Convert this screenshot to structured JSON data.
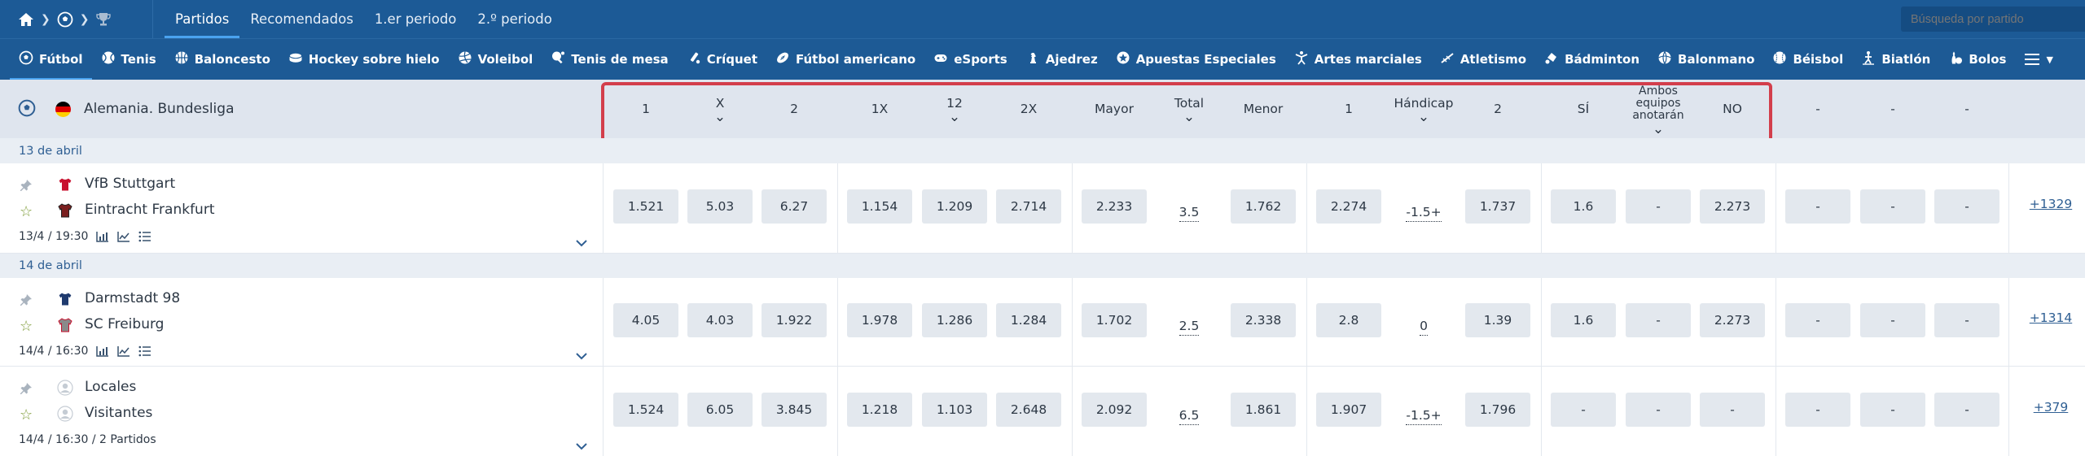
{
  "topnav": {
    "tabs": [
      "Partidos",
      "Recomendados",
      "1.er periodo",
      "2.º periodo"
    ],
    "active_tab": "Partidos",
    "search_placeholder": "Búsqueda por partido"
  },
  "sports": [
    {
      "label": "Fútbol",
      "icon": "soccer-ball-icon",
      "active": true
    },
    {
      "label": "Tenis",
      "icon": "tennis-ball-icon"
    },
    {
      "label": "Baloncesto",
      "icon": "basketball-icon"
    },
    {
      "label": "Hockey sobre hielo",
      "icon": "hockey-puck-icon"
    },
    {
      "label": "Voleibol",
      "icon": "volleyball-icon"
    },
    {
      "label": "Tenis de mesa",
      "icon": "table-tennis-icon"
    },
    {
      "label": "Críquet",
      "icon": "cricket-bat-icon"
    },
    {
      "label": "Fútbol americano",
      "icon": "american-football-icon"
    },
    {
      "label": "eSports",
      "icon": "gamepad-icon"
    },
    {
      "label": "Ajedrez",
      "icon": "chess-icon"
    },
    {
      "label": "Apuestas Especiales",
      "icon": "star-circle-icon"
    },
    {
      "label": "Artes marciales",
      "icon": "martial-arts-icon"
    },
    {
      "label": "Atletismo",
      "icon": "athletics-icon"
    },
    {
      "label": "Bádminton",
      "icon": "shuttlecock-icon"
    },
    {
      "label": "Balonmano",
      "icon": "handball-icon"
    },
    {
      "label": "Béisbol",
      "icon": "baseball-icon"
    },
    {
      "label": "Biatlón",
      "icon": "biathlon-icon"
    },
    {
      "label": "Bolos",
      "icon": "bowling-pin-icon"
    }
  ],
  "league": {
    "name": "Alemania. Bundesliga",
    "flag_colors": [
      "#000000",
      "#dd0000",
      "#ffce00"
    ],
    "columns": [
      "1",
      "X",
      "2",
      "1X",
      "12",
      "2X",
      "Mayor",
      "Total",
      "Menor",
      "1",
      "Hándicap",
      "2",
      "SÍ",
      "Ambos equipos anotarán",
      "NO",
      "-",
      "-",
      "-"
    ]
  },
  "dates": [
    "13 de abril",
    "14 de abril"
  ],
  "matches": [
    {
      "home": "VfB Stuttgart",
      "away": "Eintracht Frankfurt",
      "home_jersey": [
        "#c8102e",
        "#ffffff"
      ],
      "away_jersey": [
        "#7a1f1f",
        "#222222"
      ],
      "meta": "13/4 / 19:30",
      "odds": [
        "1.521",
        "5.03",
        "6.27",
        "1.154",
        "1.209",
        "2.714",
        "2.233",
        "1.762",
        "2.274",
        "1.737",
        "1.6",
        "-",
        "2.273",
        "-",
        "-",
        "-"
      ],
      "total": "3.5",
      "handicap": "-1.5+",
      "more": "+1329"
    },
    {
      "home": "Darmstadt 98",
      "away": "SC Freiburg",
      "home_jersey": [
        "#1f3a6e",
        "#ffffff"
      ],
      "away_jersey": [
        "#8a8a8a",
        "#c8102e"
      ],
      "meta": "14/4 / 16:30",
      "odds": [
        "4.05",
        "4.03",
        "1.922",
        "1.978",
        "1.286",
        "1.284",
        "1.702",
        "2.338",
        "2.8",
        "1.39",
        "1.6",
        "-",
        "2.273",
        "-",
        "-",
        "-"
      ],
      "total": "2.5",
      "handicap": "0",
      "more": "+1314"
    },
    {
      "home": "Locales",
      "away": "Visitantes",
      "home_jersey": [],
      "away_jersey": [],
      "meta": "14/4 / 16:30 / 2 Partidos",
      "odds": [
        "1.524",
        "6.05",
        "3.845",
        "1.218",
        "1.103",
        "2.648",
        "2.092",
        "1.861",
        "1.907",
        "1.796",
        "-",
        "-",
        "-",
        "-",
        "-",
        "-"
      ],
      "total": "6.5",
      "handicap": "-1.5+",
      "more": "+379"
    }
  ]
}
